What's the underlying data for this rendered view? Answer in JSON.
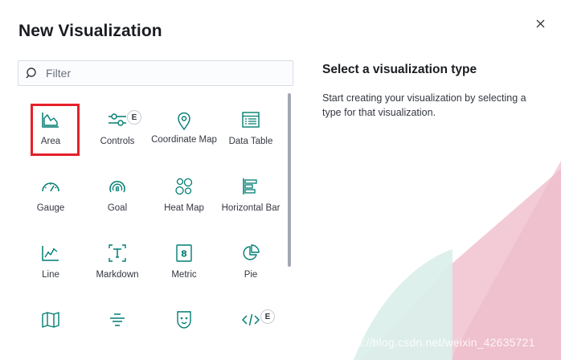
{
  "modal": {
    "title": "New Visualization",
    "close_icon": "close-icon"
  },
  "filter": {
    "placeholder": "Filter",
    "value": "",
    "icon": "search-icon"
  },
  "tiles": [
    {
      "label": "Area",
      "icon": "area-chart-icon",
      "selected": true
    },
    {
      "label": "Controls",
      "icon": "controls-sliders-icon",
      "badge": "E"
    },
    {
      "label": "Coordinate Map",
      "icon": "map-pin-icon"
    },
    {
      "label": "Data Table",
      "icon": "data-table-icon"
    },
    {
      "label": "Gauge",
      "icon": "gauge-icon"
    },
    {
      "label": "Goal",
      "icon": "goal-icon"
    },
    {
      "label": "Heat Map",
      "icon": "heatmap-icon"
    },
    {
      "label": "Horizontal Bar",
      "icon": "horizontal-bar-icon"
    },
    {
      "label": "Line",
      "icon": "line-chart-icon"
    },
    {
      "label": "Markdown",
      "icon": "markdown-icon"
    },
    {
      "label": "Metric",
      "icon": "metric-icon"
    },
    {
      "label": "Pie",
      "icon": "pie-chart-icon"
    },
    {
      "label": "",
      "icon": "region-map-icon"
    },
    {
      "label": "",
      "icon": "tag-cloud-icon"
    },
    {
      "label": "",
      "icon": "timeline-icon"
    },
    {
      "label": "",
      "icon": "code-icon",
      "badge": "E"
    }
  ],
  "side_panel": {
    "title": "Select a visualization type",
    "description": "Start creating your visualization by selecting a type for that visualization."
  },
  "watermark": "https://blog.csdn.net/weixin_42635721",
  "colors": {
    "accent": "#017d73",
    "selection_outline": "#e5202b",
    "deco_pink": "#f0c4cf",
    "deco_teal": "#d6ece8"
  }
}
